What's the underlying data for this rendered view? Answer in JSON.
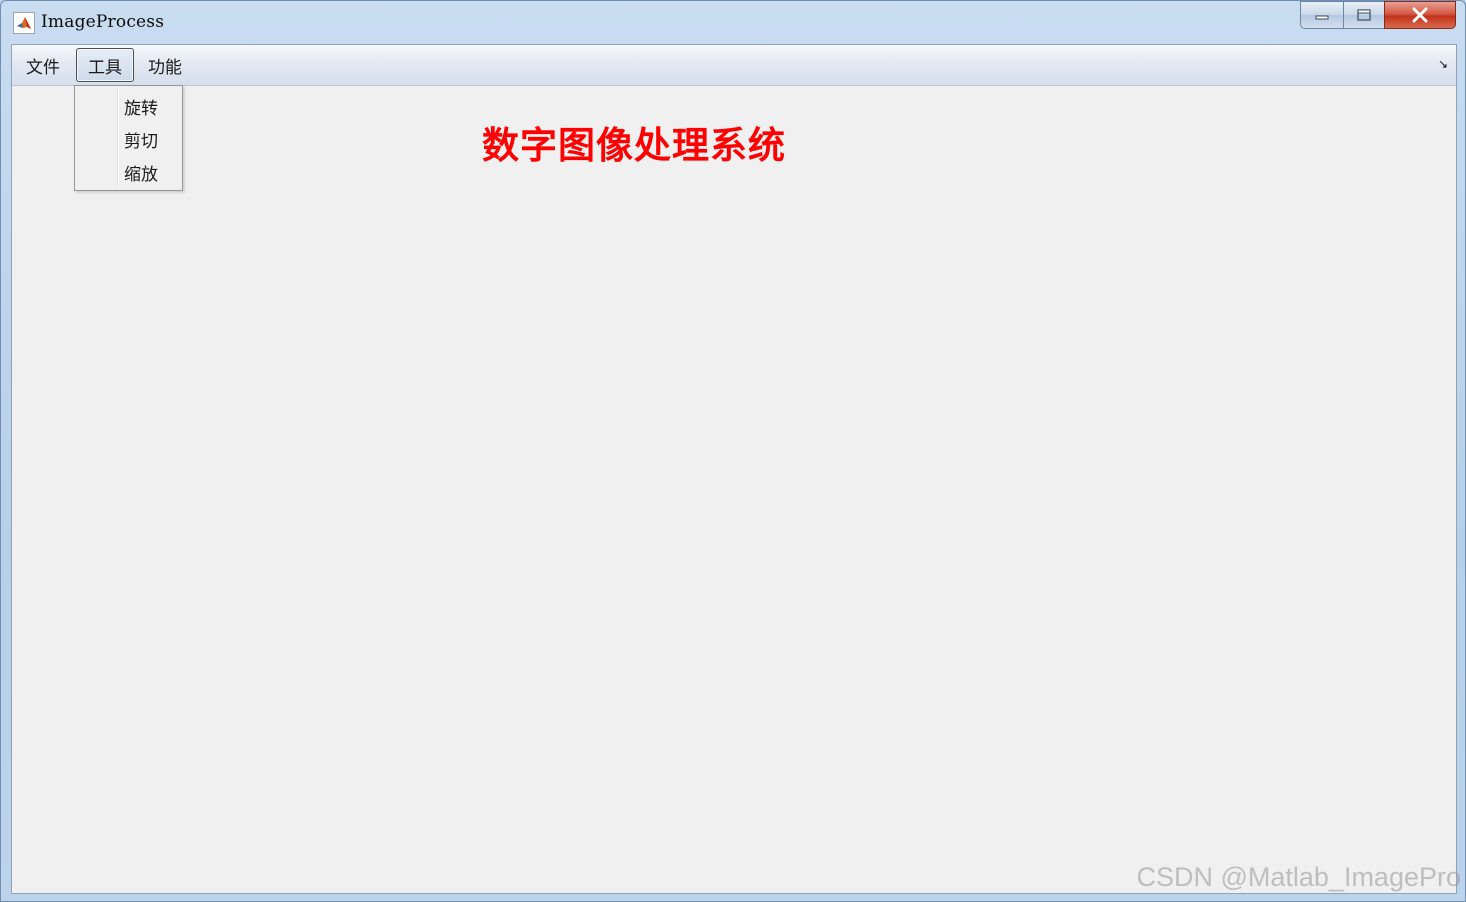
{
  "window": {
    "title": "ImageProcess",
    "controls": {
      "minimize": "minimize",
      "maximize": "maximize",
      "close": "close"
    }
  },
  "menubar": {
    "items": [
      {
        "label": "文件"
      },
      {
        "label": "工具",
        "open": true
      },
      {
        "label": "功能"
      }
    ]
  },
  "dropdown": {
    "items": [
      {
        "label": "旋转"
      },
      {
        "label": "剪切"
      },
      {
        "label": "缩放"
      }
    ]
  },
  "main": {
    "heading": "数字图像处理系统",
    "heading_color": "#ff0000"
  },
  "watermark": "CSDN @Matlab_ImagePro"
}
